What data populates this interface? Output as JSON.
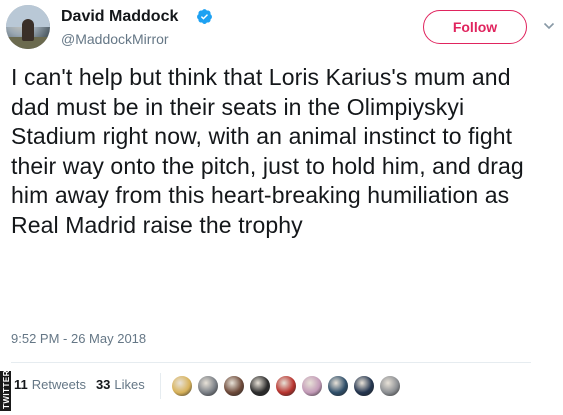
{
  "user": {
    "name": "David Maddock",
    "handle": "@MaddockMirror",
    "verified": true
  },
  "follow_label": "Follow",
  "tweet": {
    "text": "I can't help but think that Loris Karius's mum and dad must be in their seats in the Olimpiyskyi Stadium right now, with an animal instinct to fight their way onto the pitch, just to hold him, and drag him away from this heart-breaking humiliation as Real Madrid raise the trophy",
    "timestamp": "9:52 PM - 26 May 2018"
  },
  "stats": {
    "retweets_count": "11",
    "retweets_label": "Retweets",
    "likes_count": "33",
    "likes_label": "Likes"
  },
  "watermark": "TWITTER",
  "colors": {
    "accent": "#e0245e",
    "verified": "#1da1f2",
    "muted": "#657786",
    "text": "#14171a"
  },
  "icons": {
    "verified": "verified-badge-icon",
    "caret": "chevron-down-icon"
  },
  "likers": [
    {
      "color": "#d8b25a"
    },
    {
      "color": "#7a7f86"
    },
    {
      "color": "#6e4a3a"
    },
    {
      "color": "#2c2c2c"
    },
    {
      "color": "#b8342f"
    },
    {
      "color": "#c39bb8"
    },
    {
      "color": "#2f4f6a"
    },
    {
      "color": "#23354f"
    },
    {
      "color": "#8c8f93"
    }
  ]
}
